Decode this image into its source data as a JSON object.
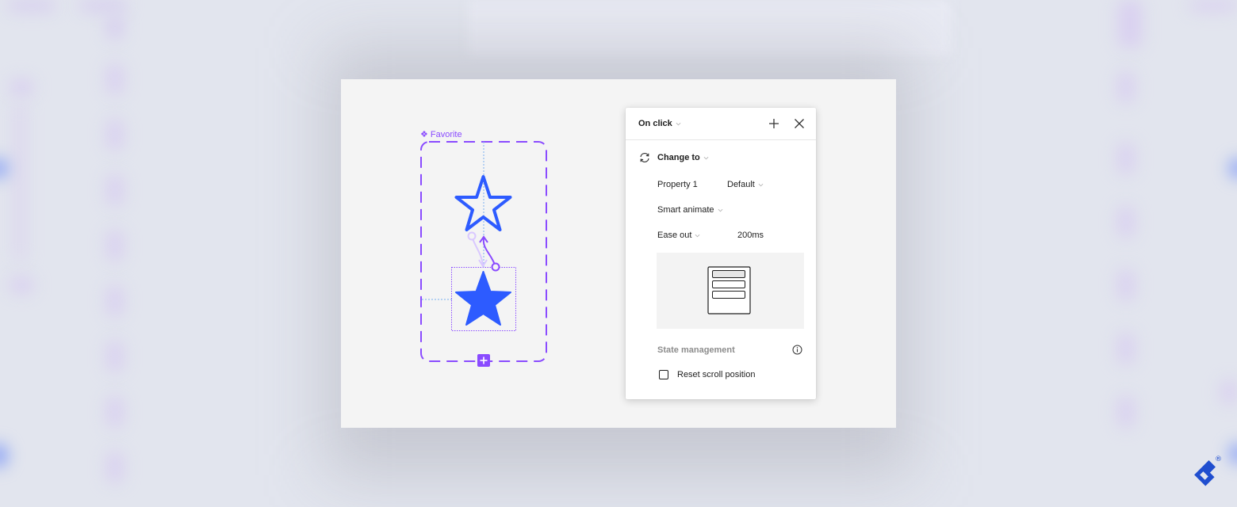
{
  "component": {
    "name": "Favorite",
    "icon": "component-icon",
    "variants": [
      "star-outline",
      "star-filled"
    ],
    "colors": {
      "component_purple": "#8a4bff",
      "star_blue": "#2d5bff",
      "guide_blue": "#8fbcf0",
      "connector_light": "#d9c8ff"
    }
  },
  "panel": {
    "trigger_label": "On click",
    "add_icon": "plus-icon",
    "close_icon": "close-icon",
    "action": {
      "icon": "change-to-icon",
      "label": "Change to"
    },
    "property": {
      "label": "Property 1",
      "value": "Default"
    },
    "animation": "Smart animate",
    "easing": "Ease out",
    "duration": "200ms",
    "state_management": {
      "label": "State management",
      "info_icon": "info-icon"
    },
    "reset_scroll": {
      "label": "Reset scroll position",
      "checked": false
    }
  },
  "brand": {
    "logo": "toptal-logo",
    "registered_mark": "®",
    "color": "#204ecf"
  }
}
